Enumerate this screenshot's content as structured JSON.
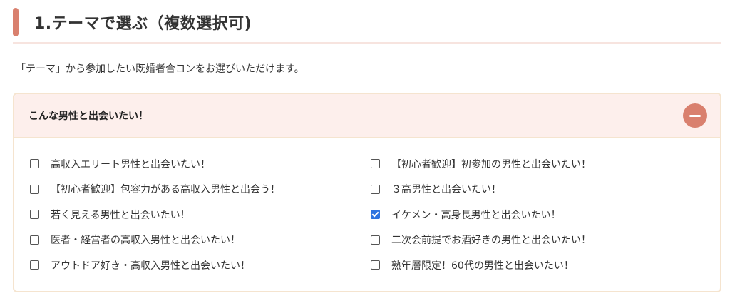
{
  "section": {
    "heading": "1.テーマで選ぶ（複数選択可)",
    "lead": "「テーマ」から参加したい既婚者合コンをお選びいただけます。"
  },
  "panel": {
    "title": "こんな男性と出会いたい！",
    "collapse_icon": "minus-icon",
    "accent_color": "#d9806e",
    "options": [
      {
        "label": "高収入エリート男性と出会いたい！",
        "checked": false
      },
      {
        "label": "【初心者歓迎】初参加の男性と出会いたい！",
        "checked": false
      },
      {
        "label": "【初心者歓迎】包容力がある高収入男性と出会う！",
        "checked": false
      },
      {
        "label": "３高男性と出会いたい！",
        "checked": false
      },
      {
        "label": "若く見える男性と出会いたい！",
        "checked": false
      },
      {
        "label": "イケメン・高身長男性と出会いたい！",
        "checked": true
      },
      {
        "label": "医者・経営者の高収入男性と出会いたい！",
        "checked": false
      },
      {
        "label": "二次会前提でお酒好きの男性と出会いたい！",
        "checked": false
      },
      {
        "label": "アウトドア好き・高収入男性と出会いたい！",
        "checked": false
      },
      {
        "label": "熟年層限定！60代の男性と出会いたい！",
        "checked": false
      }
    ]
  }
}
